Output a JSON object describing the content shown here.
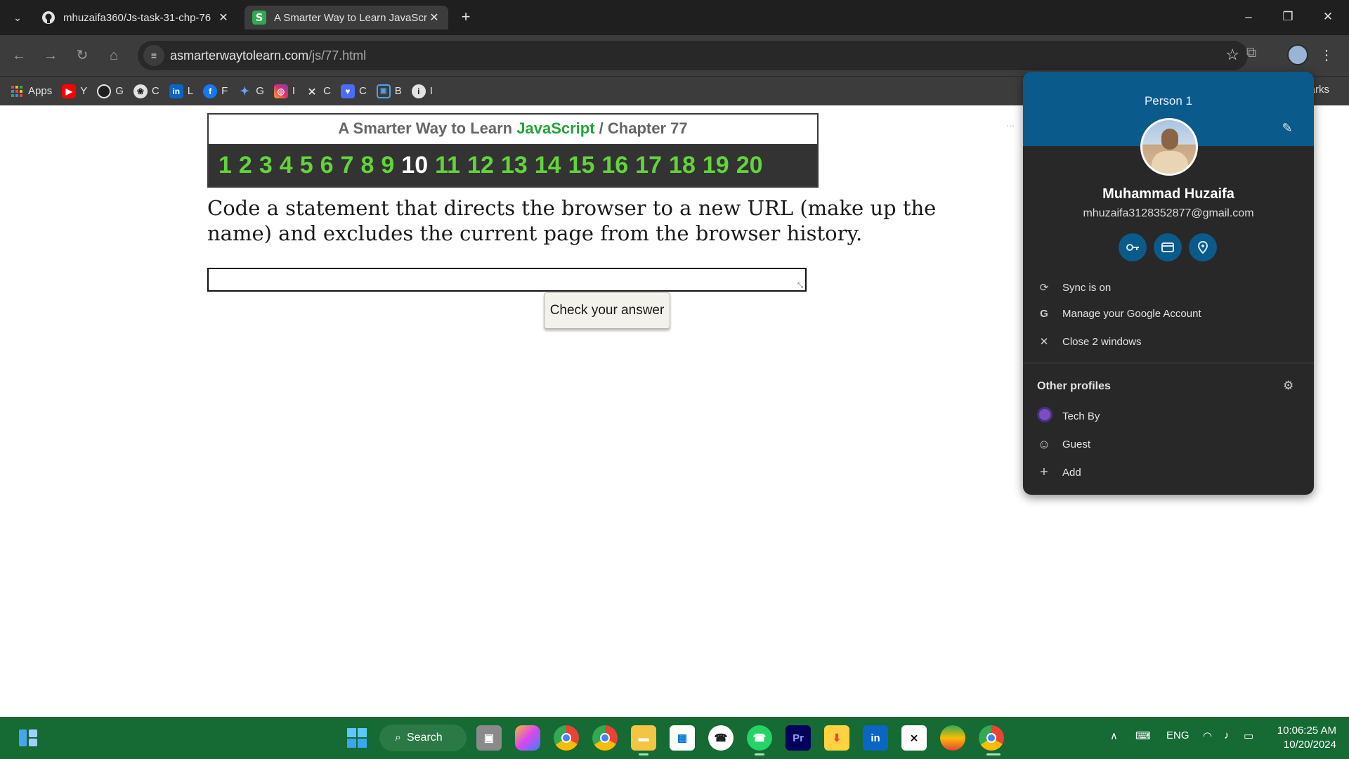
{
  "tabs": [
    {
      "title": "mhuzaifa360/Js-task-31-chp-76",
      "favicon": "github-icon",
      "active": false
    },
    {
      "title": "A Smarter Way to Learn JavaScr",
      "favicon": "smarterway-s-icon",
      "active": true
    }
  ],
  "address_bar": {
    "domain": "asmarterwaytolearn.com",
    "path": "/js/77.html"
  },
  "bookmarks": [
    {
      "label": "Apps",
      "icon": "apps-grid-icon"
    },
    {
      "label": "Y",
      "icon": "youtube-icon"
    },
    {
      "label": "G",
      "icon": "github-icon"
    },
    {
      "label": "C",
      "icon": "chatgpt-icon"
    },
    {
      "label": "L",
      "icon": "linkedin-icon"
    },
    {
      "label": "F",
      "icon": "facebook-icon"
    },
    {
      "label": "G",
      "icon": "gemini-icon"
    },
    {
      "label": "I",
      "icon": "instagram-icon"
    },
    {
      "label": "C",
      "icon": "capcut-icon"
    },
    {
      "label": "C",
      "icon": "heart-chat-icon"
    },
    {
      "label": "B",
      "icon": "bot-icon"
    },
    {
      "label": "I",
      "icon": "info-icon"
    }
  ],
  "bookmarks_right": "narks",
  "page": {
    "banner_prefix": "A Smarter Way to Learn",
    "banner_js": "JavaScript",
    "banner_sep": "/",
    "banner_chapter": "Chapter 77",
    "numbers": [
      "1",
      "2",
      "3",
      "4",
      "5",
      "6",
      "7",
      "8",
      "9",
      "10",
      "11",
      "12",
      "13",
      "14",
      "15",
      "16",
      "17",
      "18",
      "19",
      "20"
    ],
    "current_number": "10",
    "question": "Code a statement that directs the browser to a new URL (make up the name) and excludes the current page from the browser history.",
    "answer_value": "",
    "check_button": "Check your answer"
  },
  "profile": {
    "header_name": "Person 1",
    "full_name": "Muhammad Huzaifa",
    "email": "mhuzaifa3128352877@gmail.com",
    "quick_icons": [
      "key-icon",
      "payment-card-icon",
      "location-pin-icon"
    ],
    "rows": [
      {
        "label": "Sync is on",
        "icon": "sync-icon"
      },
      {
        "label": "Manage your Google Account",
        "icon": "google-g-icon"
      },
      {
        "label": "Close 2 windows",
        "icon": "close-icon"
      }
    ],
    "other_profiles_title": "Other profiles",
    "other_profiles": [
      {
        "label": "Tech By",
        "icon": "tech-by-avatar-icon"
      },
      {
        "label": "Guest",
        "icon": "guest-icon"
      },
      {
        "label": "Add",
        "icon": "plus-icon"
      }
    ]
  },
  "taskbar": {
    "search_label": "Search",
    "language": "ENG",
    "time": "10:06:25 AM",
    "date": "10/20/2024"
  },
  "colors": {
    "banner_number": "#63d33c",
    "banner_js": "#22a33a",
    "profile_header": "#0b5a8c",
    "taskbar": "#166a33"
  }
}
